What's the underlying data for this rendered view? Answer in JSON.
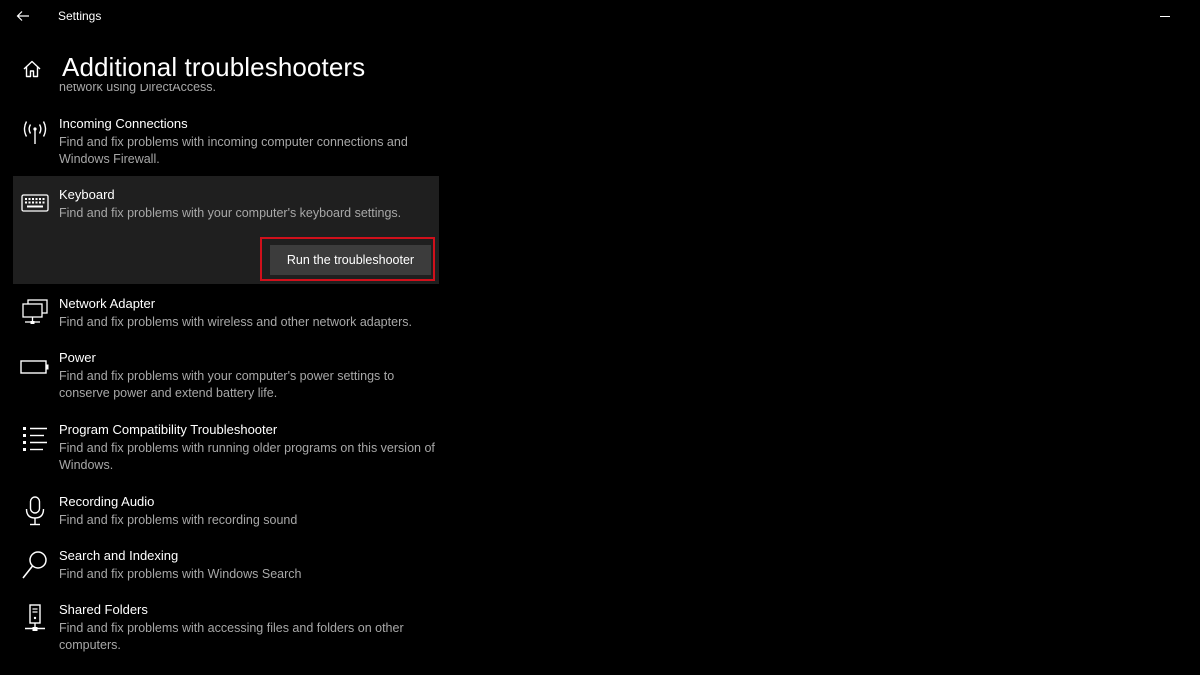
{
  "window": {
    "app_title": "Settings"
  },
  "header": {
    "title": "Additional troubleshooters"
  },
  "cutoff_text": "network using DirectAccess.",
  "troubleshooters": [
    {
      "name": "Incoming Connections",
      "description": "Find and fix problems with incoming computer connections and Windows Firewall.",
      "icon": "antenna-icon"
    },
    {
      "name": "Keyboard",
      "description": "Find and fix problems with your computer's keyboard settings.",
      "icon": "keyboard-icon",
      "selected": true,
      "action_label": "Run the troubleshooter"
    },
    {
      "name": "Network Adapter",
      "description": "Find and fix problems with wireless and other network adapters.",
      "icon": "network-adapter-icon"
    },
    {
      "name": "Power",
      "description": "Find and fix problems with your computer's power settings to conserve power and extend battery life.",
      "icon": "battery-icon"
    },
    {
      "name": "Program Compatibility Troubleshooter",
      "description": "Find and fix problems with running older programs on this version of Windows.",
      "icon": "list-icon"
    },
    {
      "name": "Recording Audio",
      "description": "Find and fix problems with recording sound",
      "icon": "microphone-icon"
    },
    {
      "name": "Search and Indexing",
      "description": "Find and fix problems with Windows Search",
      "icon": "search-icon"
    },
    {
      "name": "Shared Folders",
      "description": "Find and fix problems with accessing files and folders on other computers.",
      "icon": "shared-folders-icon"
    }
  ],
  "colors": {
    "background": "#000000",
    "selected_background": "#1f1f1f",
    "button_background": "#3c3c3c",
    "highlight_border": "#d0101b",
    "secondary_text": "#a8a8a8"
  }
}
